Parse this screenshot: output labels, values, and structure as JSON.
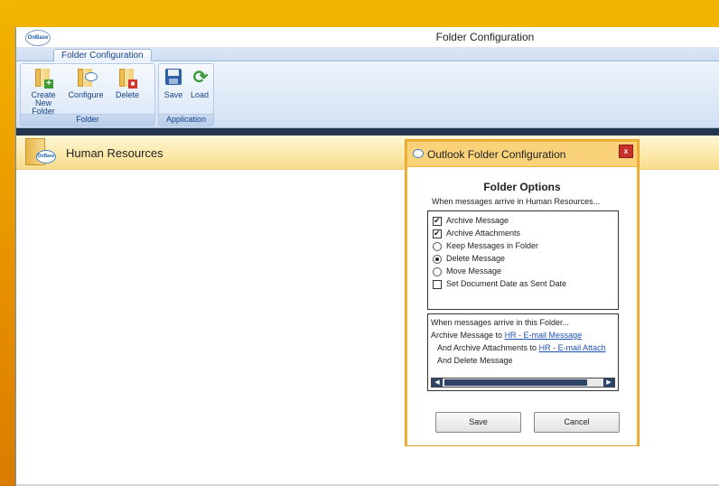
{
  "window": {
    "title": "Folder Configuration",
    "logo_text": "OnBase"
  },
  "ribbon": {
    "tab": "Folder Configuration",
    "groups": {
      "folder": {
        "label": "Folder",
        "create_label": "Create New Folder",
        "configure_label": "Configure",
        "delete_label": "Delete"
      },
      "application": {
        "label": "Application",
        "save_label": "Save",
        "load_label": "Load"
      }
    }
  },
  "folder_header": {
    "name": "Human Resources",
    "logo_text": "OnBase"
  },
  "dialog": {
    "title": "Outlook Folder Configuration",
    "close": "x",
    "heading": "Folder Options",
    "subtitle": "When messages arrive in Human Resources...",
    "options": [
      {
        "label": "Archive Message",
        "type": "checkbox",
        "checked": true
      },
      {
        "label": "Archive Attachments",
        "type": "checkbox",
        "checked": true
      },
      {
        "label": "Keep Messages in Folder",
        "type": "radio",
        "checked": false
      },
      {
        "label": "Delete Message",
        "type": "radio",
        "checked": true
      },
      {
        "label": "Move Message",
        "type": "radio",
        "checked": false
      },
      {
        "label": "Set Document Date as Sent Date",
        "type": "checkbox",
        "checked": false
      }
    ],
    "summary": {
      "intro": "When messages arrive in this Folder...",
      "archive_prefix": "Archive Message to",
      "archive_link": "HR - E-mail Message",
      "attach_prefix": "And Archive Attachments to",
      "attach_link": "HR - E-mail Attach",
      "delete_line": "And Delete Message"
    },
    "save_label": "Save",
    "cancel_label": "Cancel"
  },
  "colors": {
    "accent_orange": "#f0b238",
    "ribbon_blue": "#15428b",
    "link_blue": "#1a52b8"
  }
}
